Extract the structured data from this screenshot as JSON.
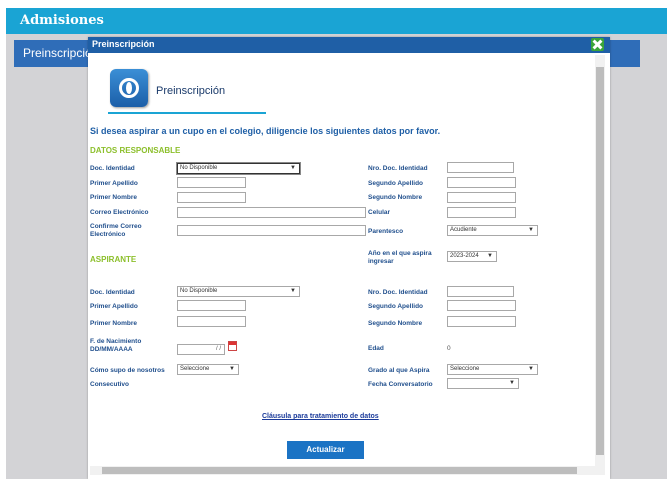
{
  "app": {
    "title": "Admisiones"
  },
  "tab": {
    "label": "Preinscripción"
  },
  "modal": {
    "title": "Preinscripción",
    "page_title": "Preinscripción",
    "intro": "Si desea aspirar a un cupo en el colegio, diligencie los siguientes datos por favor.",
    "sections": {
      "responsable": "DATOS RESPONSABLE",
      "aspirante": "ASPIRANTE"
    },
    "responsable": {
      "doc_identidad_label": "Doc. Identidad",
      "doc_identidad_value": "No Disponible",
      "nro_doc_label": "Nro. Doc. Identidad",
      "primer_apellido_label": "Primer Apellido",
      "segundo_apellido_label": "Segundo Apellido",
      "primer_nombre_label": "Primer Nombre",
      "segundo_nombre_label": "Segundo Nombre",
      "correo_label": "Correo Electrónico",
      "celular_label": "Celular",
      "confirme_label_1": "Confirme Correo",
      "confirme_label_2": "Electrónico",
      "parentesco_label": "Parentesco",
      "parentesco_value": "Acudiente"
    },
    "anio": {
      "label_1": "Año en el que aspira",
      "label_2": "ingresar",
      "value": "2023-2024"
    },
    "aspirante": {
      "doc_identidad_label": "Doc. Identidad",
      "doc_identidad_value": "No Disponible",
      "nro_doc_label": "Nro. Doc. Identidad",
      "primer_apellido_label": "Primer Apellido",
      "segundo_apellido_label": "Segundo Apellido",
      "primer_nombre_label": "Primer Nombre",
      "segundo_nombre_label": "Segundo Nombre",
      "nacimiento_label_1": "F. de Nacimiento",
      "nacimiento_label_2": "DD/MM/AAAA",
      "nacimiento_value": "/ /",
      "edad_label": "Edad",
      "edad_value": "0",
      "como_supo_label": "Cómo supo de nosotros",
      "como_supo_value": "Seleccione",
      "grado_label": "Grado al que Aspira",
      "grado_value": "Seleccione",
      "consecutivo_label": "Consecutivo",
      "fecha_conv_label": "Fecha Conversatorio",
      "fecha_conv_value": ""
    },
    "link": "Cláusula para tratamiento de datos",
    "button": "Actualizar"
  },
  "colors": {
    "topbar": "#1aa4d4",
    "header": "#1f5fa6",
    "section": "#8cbf2b",
    "label": "#1f4e8c"
  },
  "icons": [
    "logo-icon",
    "close-icon",
    "calendar-icon",
    "chevron-down-icon"
  ]
}
